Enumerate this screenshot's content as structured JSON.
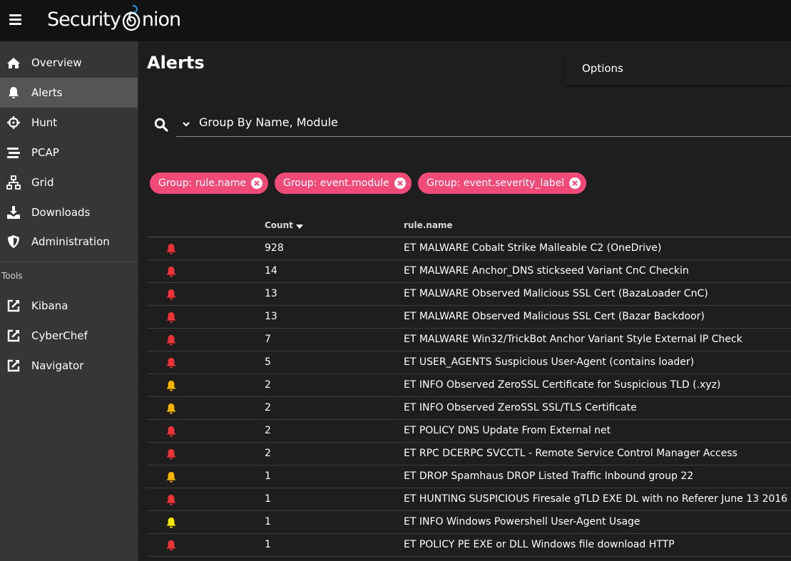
{
  "app": {
    "logo_text_1": "Security",
    "logo_text_2": "nion"
  },
  "sidebar": {
    "items": [
      {
        "label": "Overview",
        "icon": "home-icon"
      },
      {
        "label": "Alerts",
        "icon": "bell-icon",
        "active": true
      },
      {
        "label": "Hunt",
        "icon": "crosshairs-icon"
      },
      {
        "label": "PCAP",
        "icon": "stream-icon"
      },
      {
        "label": "Grid",
        "icon": "network-icon"
      },
      {
        "label": "Downloads",
        "icon": "download-icon"
      },
      {
        "label": "Administration",
        "icon": "shield-icon"
      }
    ],
    "tools_header": "Tools",
    "tools": [
      {
        "label": "Kibana",
        "icon": "external-link-icon"
      },
      {
        "label": "CyberChef",
        "icon": "external-link-icon"
      },
      {
        "label": "Navigator",
        "icon": "external-link-icon"
      }
    ]
  },
  "main": {
    "title": "Alerts",
    "options_label": "Options",
    "query": "Group By Name, Module",
    "chips": [
      "Group: rule.name",
      "Group: event.module",
      "Group: event.severity_label"
    ],
    "columns": {
      "count": "Count",
      "rule": "rule.name"
    },
    "colors": {
      "high": "#ee3338",
      "medium": "#f4b400",
      "low": "#f6e700",
      "chip": "#ef4a78"
    },
    "rows": [
      {
        "severity": "high",
        "count": "928",
        "rule": "ET MALWARE Cobalt Strike Malleable C2 (OneDrive)"
      },
      {
        "severity": "high",
        "count": "14",
        "rule": "ET MALWARE Anchor_DNS stickseed Variant CnC Checkin"
      },
      {
        "severity": "high",
        "count": "13",
        "rule": "ET MALWARE Observed Malicious SSL Cert (BazaLoader CnC)"
      },
      {
        "severity": "high",
        "count": "13",
        "rule": "ET MALWARE Observed Malicious SSL Cert (Bazar Backdoor)"
      },
      {
        "severity": "high",
        "count": "7",
        "rule": "ET MALWARE Win32/TrickBot Anchor Variant Style External IP Check"
      },
      {
        "severity": "high",
        "count": "5",
        "rule": "ET USER_AGENTS Suspicious User-Agent (contains loader)"
      },
      {
        "severity": "medium",
        "count": "2",
        "rule": "ET INFO Observed ZeroSSL Certificate for Suspicious TLD (.xyz)"
      },
      {
        "severity": "medium",
        "count": "2",
        "rule": "ET INFO Observed ZeroSSL SSL/TLS Certificate"
      },
      {
        "severity": "high",
        "count": "2",
        "rule": "ET POLICY DNS Update From External net"
      },
      {
        "severity": "high",
        "count": "2",
        "rule": "ET RPC DCERPC SVCCTL - Remote Service Control Manager Access"
      },
      {
        "severity": "medium",
        "count": "1",
        "rule": "ET DROP Spamhaus DROP Listed Traffic Inbound group 22"
      },
      {
        "severity": "high",
        "count": "1",
        "rule": "ET HUNTING SUSPICIOUS Firesale gTLD EXE DL with no Referer June 13 2016"
      },
      {
        "severity": "low",
        "count": "1",
        "rule": "ET INFO Windows Powershell User-Agent Usage"
      },
      {
        "severity": "high",
        "count": "1",
        "rule": "ET POLICY PE EXE or DLL Windows file download HTTP"
      }
    ]
  }
}
